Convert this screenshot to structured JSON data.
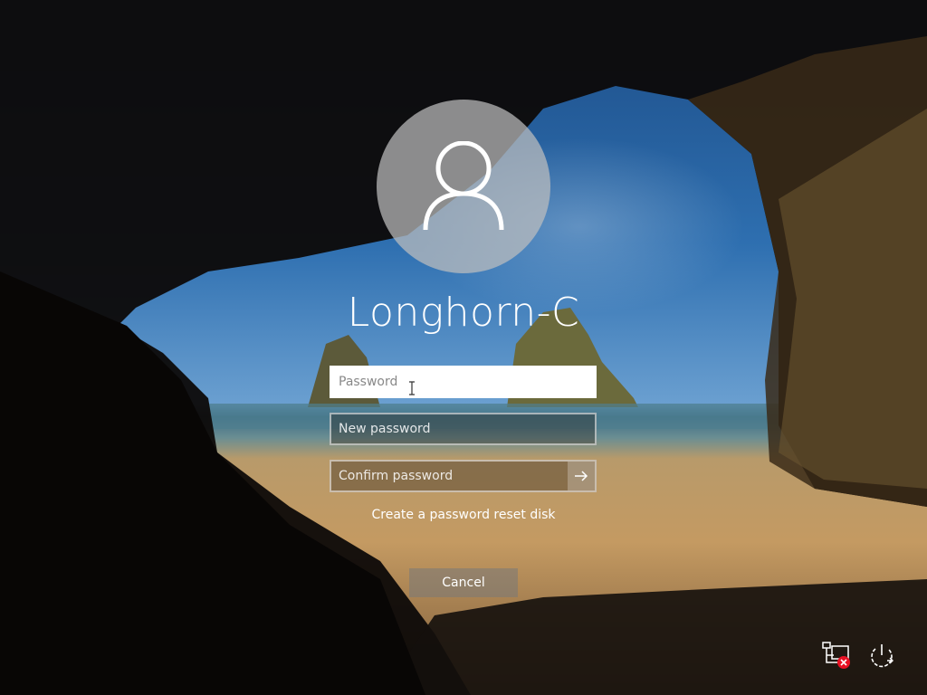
{
  "user": {
    "name": "Longhorn-C"
  },
  "form": {
    "password_placeholder": "Password",
    "new_password_placeholder": "New password",
    "confirm_password_placeholder": "Confirm password"
  },
  "links": {
    "reset_disk": "Create a password reset disk"
  },
  "buttons": {
    "cancel": "Cancel"
  },
  "icons": {
    "avatar": "user-silhouette-icon",
    "submit": "arrow-right-icon",
    "network": "network-disconnected-icon",
    "power": "power-icon"
  },
  "colors": {
    "text": "#ffffff",
    "error_badge": "#e81123"
  }
}
